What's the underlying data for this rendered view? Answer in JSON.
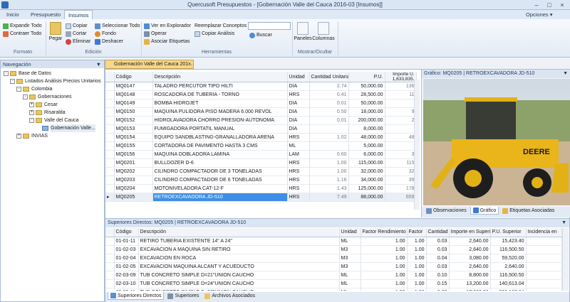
{
  "window": {
    "title": "Quercusoft Presupuestos - [Gobernación Valle del Cauca 2016-03 [Insumos]]"
  },
  "menu": {
    "tabs": [
      "Inicio",
      "Presupuesto",
      "Insumos"
    ],
    "active": "Insumos",
    "options": "Opciones"
  },
  "ribbon": {
    "formato": {
      "label": "Formato",
      "expand": "Expandir Todo",
      "collapse": "Contraer Todo"
    },
    "edicion": {
      "label": "Edición",
      "paste": "Pegar",
      "copy": "Copiar",
      "cut": "Cortar",
      "delete": "Eliminar",
      "select_all": "Seleccionar Todo",
      "background": "Fondo",
      "undo": "Deshacer"
    },
    "herramientas": {
      "label": "Herramientas",
      "explorer": "Ver en Explorador",
      "operate": "Operar",
      "tags": "Asociar Etiquetas",
      "replace": "Reemplazar Conceptos",
      "copy_analysis": "Copiar Análisis",
      "search": "Buscar"
    },
    "mostrar": {
      "label": "Mostrar/Ocultar",
      "panels": "Paneles",
      "columns": "Columnas"
    }
  },
  "nav": {
    "title": "Navegación",
    "items": [
      "Base de Datos",
      "Listados Análisis Precios Unitarios",
      "Colombia",
      "Gobernaciones",
      "Cesar",
      "Risaralda",
      "Valle del Cauca",
      "Gobernación Valle...",
      "INVIAS"
    ]
  },
  "doc_tab": "Gobernación Valle del Cauca 201...",
  "main_table": {
    "columns": [
      "Código",
      "Descripción",
      "Unidad",
      "Cantidad Unitaria",
      "P.U.",
      "Importe U."
    ],
    "total": "1,633,835.",
    "rows": [
      {
        "code": "MQ0147",
        "desc": "TALADRO PERCUTOR TIPO HILTI",
        "unit": "DIA",
        "qty": "2.74",
        "pu": "50,000.00",
        "imp": "136"
      },
      {
        "code": "MQ0148",
        "desc": "ROSCADORA DE TUBERIA - TORNO",
        "unit": "HRS",
        "qty": "0.41",
        "pu": "28,500.00",
        "imp": "11"
      },
      {
        "code": "MQ0149",
        "desc": "BOMBA HIDROJET",
        "unit": "DIA",
        "qty": "0.01",
        "pu": "50,000.00",
        "imp": ""
      },
      {
        "code": "MQ0150",
        "desc": "MAQUINA PULIDORA PISO MADERA 6.000 REVOL",
        "unit": "DIA",
        "qty": "0.50",
        "pu": "18,000.00",
        "imp": "9"
      },
      {
        "code": "MQ0152",
        "desc": "HIDROLAVADORA CHORRO PRESION-AUTONOMA",
        "unit": "DIA",
        "qty": "0.01",
        "pu": "200,000.00",
        "imp": "2"
      },
      {
        "code": "MQ0153",
        "desc": "FUMIGADORA PORTATIL MANUAL",
        "unit": "DIA",
        "qty": "",
        "pu": "8,000.00",
        "imp": ""
      },
      {
        "code": "MQ0154",
        "desc": "EQUIPO SANDBLASTING-GRANALLADORA ARENA",
        "unit": "HRS",
        "qty": "1.02",
        "pu": "48,000.00",
        "imp": "48"
      },
      {
        "code": "MQ0155",
        "desc": "CORTADORA DE PAVIMENTO HASTA 3 CMS",
        "unit": "ML",
        "qty": "",
        "pu": "5,000.00",
        "imp": ""
      },
      {
        "code": "MQ0156",
        "desc": "MAQUINA DOBLADORA LAMINA",
        "unit": "LAM",
        "qty": "0.60",
        "pu": "6,000.00",
        "imp": "3"
      },
      {
        "code": "MQ0201",
        "desc": "BULLDOZER D-6",
        "unit": "HRS",
        "qty": "1.00",
        "pu": "115,000.00",
        "imp": "115"
      },
      {
        "code": "MQ0202",
        "desc": "CILINDRO COMPACTADOR DE 3 TONELADAS",
        "unit": "HRS",
        "qty": "1.00",
        "pu": "32,000.00",
        "imp": "32"
      },
      {
        "code": "MQ0203",
        "desc": "CILINDRO COMPACTADOR DE 6 TONELADAS",
        "unit": "HRS",
        "qty": "1.16",
        "pu": "34,000.00",
        "imp": "39"
      },
      {
        "code": "MQ0204",
        "desc": "MOTONIVELADORA CAT-12-F",
        "unit": "HRS",
        "qty": "1.43",
        "pu": "125,000.00",
        "imp": "178"
      },
      {
        "code": "MQ0205",
        "desc": "RETROEXCAVADORA JD-510",
        "unit": "HRS",
        "qty": "7.49",
        "pu": "88,000.00",
        "imp": "659"
      }
    ]
  },
  "grafico": {
    "title": "Gráfico: MQ0205 | RETROEXCAVADORA JD-510",
    "brand": "DEERE",
    "tabs": [
      "Observaciones",
      "Gráfico",
      "Etiquetas Asociadas"
    ],
    "active": "Gráfico"
  },
  "superiores": {
    "title": "Superiores Directos: MQ0205 | RETROEXCAVADORA JD-510",
    "columns": [
      "Código",
      "Descripción",
      "Unidad",
      "Factor Rendimiento",
      "Factor",
      "Cantidad",
      "Importe en Superior",
      "P.U. Superior",
      "Incidencia en"
    ],
    "rows": [
      {
        "code": "01-01-11",
        "desc": "RETIRO TUBERIA EXISTENTE 14\" A 24\"",
        "unit": "ML",
        "fr": "1.00",
        "f": "1.00",
        "qty": "0.03",
        "imp": "2,640.00",
        "pu": "15,423.40"
      },
      {
        "code": "01-02-03",
        "desc": "EXCAVACION A MAQUINA SIN RETIRO",
        "unit": "M3",
        "fr": "1.00",
        "f": "1.00",
        "qty": "0.03",
        "imp": "2,640.00",
        "pu": "116,500.50"
      },
      {
        "code": "01-02-04",
        "desc": "EXCAVACION EN ROCA",
        "unit": "M3",
        "fr": "1.00",
        "f": "1.00",
        "qty": "0.04",
        "imp": "3,080.00",
        "pu": "59,520.00"
      },
      {
        "code": "01-02-05",
        "desc": "EXCAVACION MAQUINA ALCANT Y ACUEDUCTO",
        "unit": "M3",
        "fr": "1.00",
        "f": "1.00",
        "qty": "0.03",
        "imp": "2,640.00",
        "pu": "2,640.00"
      },
      {
        "code": "02-03-09",
        "desc": "TUB CONCRETO SIMPLE D=21\"UNION CAUCHO",
        "unit": "ML",
        "fr": "1.00",
        "f": "1.00",
        "qty": "0.10",
        "imp": "8,800.00",
        "pu": "116,500.50"
      },
      {
        "code": "02-03-10",
        "desc": "TUB CONCRETO SIMPLE D=24\"UNION CAUCHO",
        "unit": "ML",
        "fr": "1.00",
        "f": "1.00",
        "qty": "0.15",
        "imp": "13,200.00",
        "pu": "140,613.04"
      },
      {
        "code": "02-03-11",
        "desc": "TUB CONCRETO SIMPLE D=27\"UNION CAUCHO",
        "unit": "ML",
        "fr": "1.00",
        "f": "1.00",
        "qty": "0.20",
        "imp": "17,600.00",
        "pu": "236,167.64"
      }
    ],
    "tabs": [
      "Superiores Directos",
      "Superiores",
      "Archivos Asociados"
    ],
    "active": "Superiores Directos"
  }
}
